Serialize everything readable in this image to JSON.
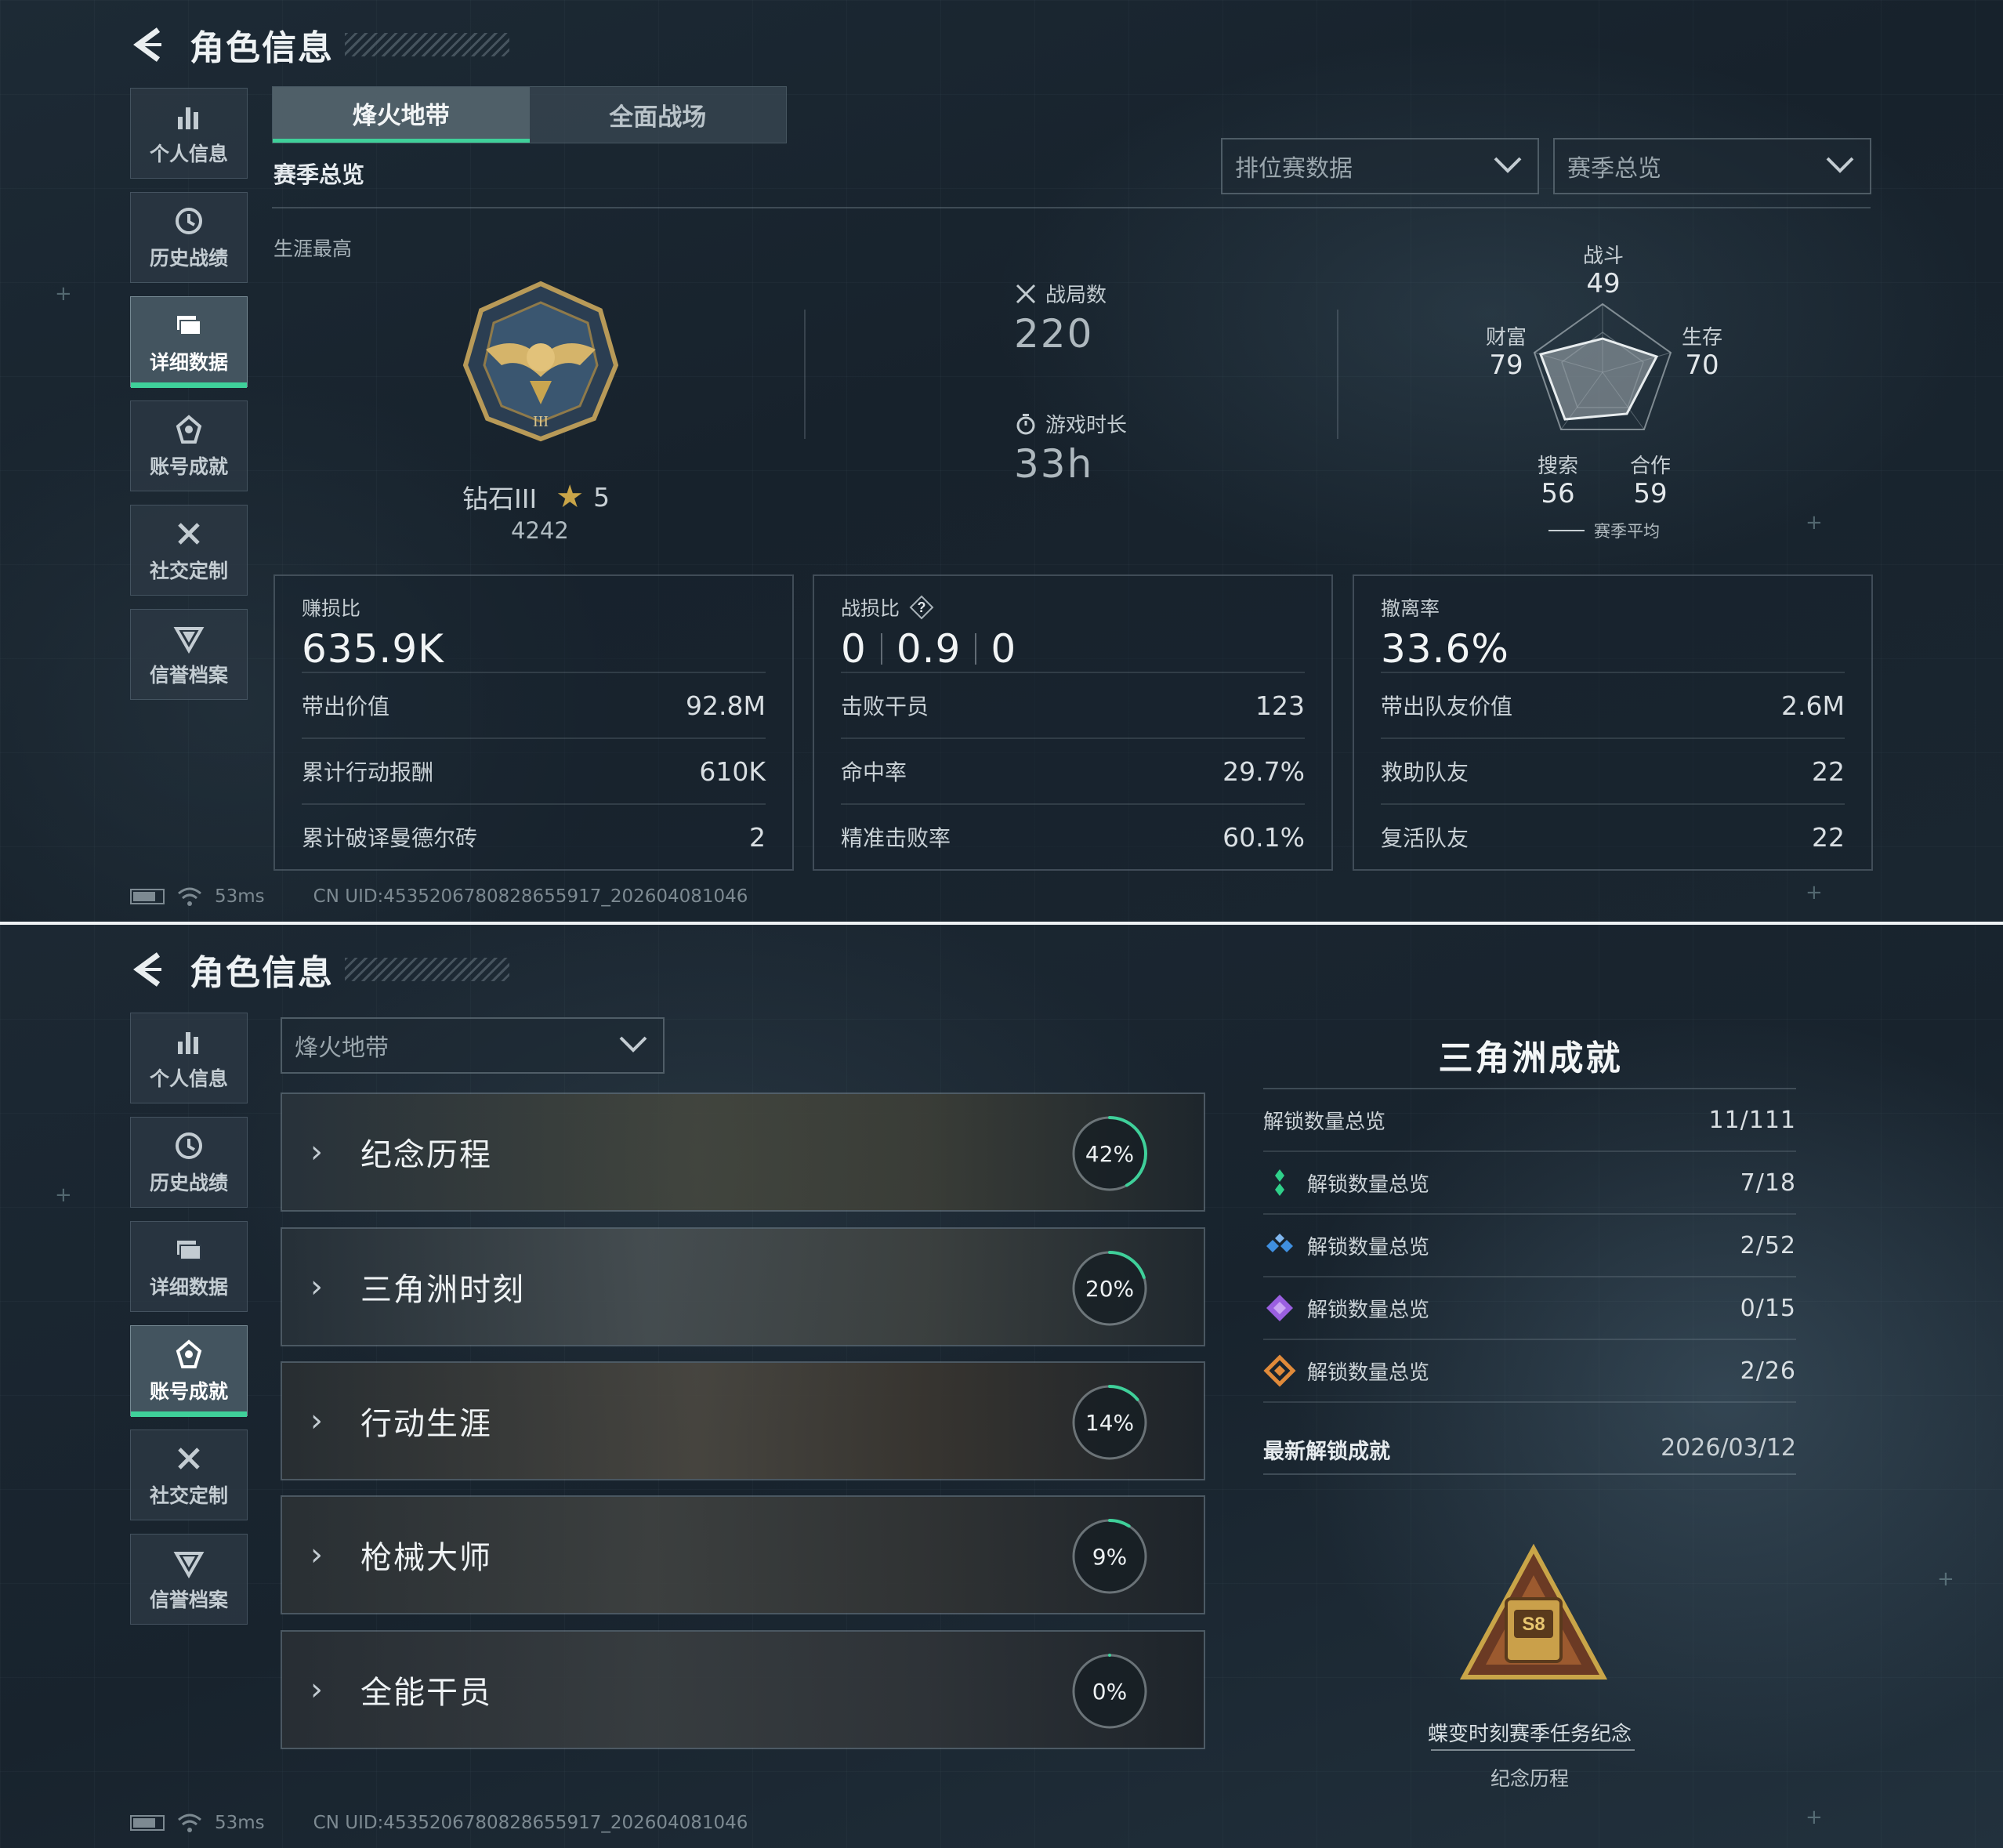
{
  "header": {
    "title": "角色信息"
  },
  "sidebar": {
    "items": [
      {
        "label": "个人信息",
        "icon": "bar-chart-icon"
      },
      {
        "label": "历史战绩",
        "icon": "clock-icon"
      },
      {
        "label": "详细数据",
        "icon": "folder-icon"
      },
      {
        "label": "账号成就",
        "icon": "achievement-icon"
      },
      {
        "label": "社交定制",
        "icon": "tools-icon"
      },
      {
        "label": "信誉档案",
        "icon": "shield-icon"
      }
    ]
  },
  "top": {
    "tabs": [
      "烽火地带",
      "全面战场"
    ],
    "section_title": "赛季总览",
    "dropdown_mode": "排位赛数据",
    "dropdown_season": "赛季总览",
    "career_label": "生涯最高",
    "rank_name": "钻石III",
    "rank_stars": "5",
    "rank_score": "4242",
    "matches_label": "战局数",
    "matches_value": "220",
    "playtime_label": "游戏时长",
    "playtime_value": "33h",
    "radar": {
      "axes": [
        {
          "label": "战斗",
          "value": "49"
        },
        {
          "label": "生存",
          "value": "70"
        },
        {
          "label": "合作",
          "value": "59"
        },
        {
          "label": "搜索",
          "value": "56"
        },
        {
          "label": "财富",
          "value": "79"
        }
      ],
      "legend": "赛季平均"
    },
    "panels": [
      {
        "title": "赚损比",
        "big": "635.9K",
        "rows": [
          {
            "label": "带出价值",
            "value": "92.8M"
          },
          {
            "label": "累计行动报酬",
            "value": "610K"
          },
          {
            "label": "累计破译曼德尔砖",
            "value": "2"
          }
        ]
      },
      {
        "title": "战损比",
        "big_parts": [
          "0",
          "0.9",
          "0"
        ],
        "rows": [
          {
            "label": "击败干员",
            "value": "123"
          },
          {
            "label": "命中率",
            "value": "29.7%"
          },
          {
            "label": "精准击败率",
            "value": "60.1%"
          }
        ]
      },
      {
        "title": "撤离率",
        "big": "33.6%",
        "rows": [
          {
            "label": "带出队友价值",
            "value": "2.6M"
          },
          {
            "label": "救助队友",
            "value": "22"
          },
          {
            "label": "复活队友",
            "value": "22"
          }
        ]
      }
    ]
  },
  "footer": {
    "ping": "53ms",
    "uid": "CN UID:4535206780828655917_202604081046"
  },
  "bottom": {
    "mode_dropdown": "烽火地带",
    "categories": [
      {
        "name": "纪念历程",
        "percent": "42%",
        "progress": 0.42
      },
      {
        "name": "三角洲时刻",
        "percent": "20%",
        "progress": 0.2
      },
      {
        "name": "行动生涯",
        "percent": "14%",
        "progress": 0.14
      },
      {
        "name": "枪械大师",
        "percent": "9%",
        "progress": 0.09
      },
      {
        "name": "全能干员",
        "percent": "0%",
        "progress": 0.0
      }
    ],
    "achievements_title": "三角洲成就",
    "summary": [
      {
        "label": "解锁数量总览",
        "value": "11/111",
        "icon": ""
      },
      {
        "label": "解锁数量总览",
        "value": "7/18",
        "icon": "green-diamond-icon",
        "color": "#2fd08a"
      },
      {
        "label": "解锁数量总览",
        "value": "2/52",
        "icon": "blue-diamond-icon",
        "color": "#3f8fe0"
      },
      {
        "label": "解锁数量总览",
        "value": "0/15",
        "icon": "purple-diamond-icon",
        "color": "#9a5fe0"
      },
      {
        "label": "解锁数量总览",
        "value": "2/26",
        "icon": "orange-diamond-icon",
        "color": "#e08a3a"
      }
    ],
    "latest_label": "最新解锁成就",
    "latest_date": "2026/03/12",
    "latest_name": "蝶变时刻赛季任务纪念",
    "latest_category": "纪念历程",
    "badge_text": "S8"
  },
  "colors": {
    "accent": "#3fd09a"
  }
}
